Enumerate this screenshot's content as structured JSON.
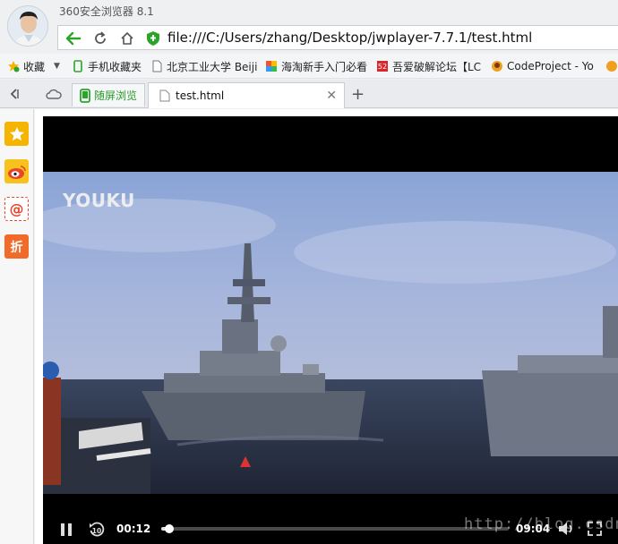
{
  "window": {
    "title": "360安全浏览器 8.1"
  },
  "address_bar": {
    "url": "file:///C:/Users/zhang/Desktop/jwplayer-7.7.1/test.html"
  },
  "bookmarks": [
    {
      "label": "收藏",
      "icon": "star-icon"
    },
    {
      "label": "手机收藏夹",
      "icon": "phone-icon"
    },
    {
      "label": "北京工业大学 Beiji",
      "icon": "page-icon"
    },
    {
      "label": "海淘新手入门必看",
      "icon": "colorful-icon"
    },
    {
      "label": "吾爱破解论坛【LC",
      "icon": "forum-icon"
    },
    {
      "label": "CodeProject - Yo",
      "icon": "codeproject-icon"
    }
  ],
  "tabs": [
    {
      "label": "随屏浏览",
      "pinned": true
    },
    {
      "label": "test.html",
      "active": true
    }
  ],
  "sidebar": [
    {
      "name": "favorites",
      "icon": "star-icon",
      "color": "#f5b400"
    },
    {
      "name": "weibo",
      "icon": "weibo-icon",
      "color": "#e8452c"
    },
    {
      "name": "mail",
      "icon": "at-icon",
      "color": "#e8452c"
    },
    {
      "name": "discount",
      "icon": "discount-icon",
      "label": "折",
      "color": "#f06a2a"
    }
  ],
  "player": {
    "logo_text": "YOUKU",
    "time_elapsed": "00:12",
    "time_duration": "09:04",
    "progress_fraction": 0.022,
    "watermark": "http://blog.csdn.net/"
  }
}
